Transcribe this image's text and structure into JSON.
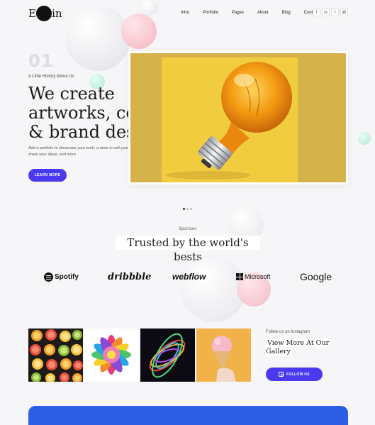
{
  "header": {
    "logo_text": "Evelin",
    "nav": [
      "Intro",
      "Portfolio",
      "Pages",
      "About",
      "Blog",
      "Contact"
    ],
    "social_icons": [
      "facebook-icon",
      "instagram-icon",
      "twitter-icon",
      "threads-icon"
    ],
    "social_glyphs": [
      "f",
      "◎",
      "t",
      "@"
    ]
  },
  "hero": {
    "number": "01",
    "eyebrow": "A Little History About Us",
    "title_lines": [
      "We create",
      "artworks, concepts,",
      "& brand design"
    ],
    "description": "Add a portfolio to showcase your work, a store to sell your products or services, a blog to share your ideas, and more.",
    "button_label": "LEARN MORE",
    "slider_dots": 3,
    "active_dot": 0
  },
  "sponsors": {
    "eyebrow": "Sponsors",
    "title": "Trusted by the world's bests",
    "logos": [
      "Spotify",
      "dribbble",
      "webflow",
      "Microsoft",
      "Google"
    ]
  },
  "instagram": {
    "eyebrow": "Follow us on Instagram",
    "title": "View More At Our Gallery",
    "button_label": "FOLLOW US"
  },
  "colors": {
    "accent": "#4a3aef",
    "footer": "#2f5ee6",
    "hero_bg": "#d6b24a",
    "hero_card": "#f1cc3e"
  }
}
